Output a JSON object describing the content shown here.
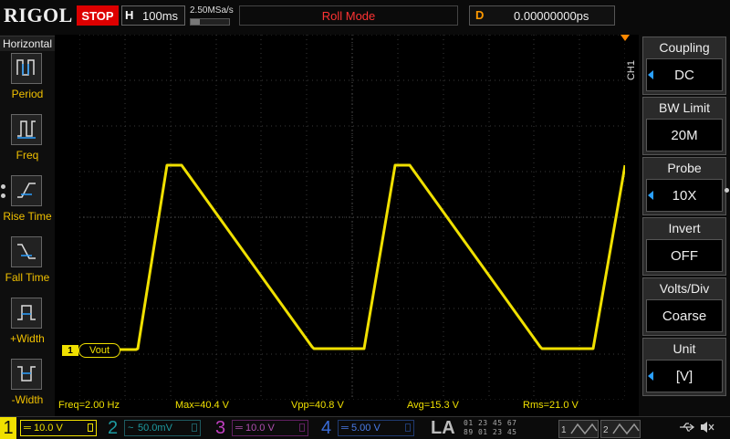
{
  "top": {
    "logo": "RIGOL",
    "run_state": "STOP",
    "timebase_tag": "H",
    "timebase": "100ms",
    "sample_rate": "2.50MSa/s",
    "mode": "Roll Mode",
    "delay_tag": "D",
    "delay": "0.00000000ps"
  },
  "left_menu": {
    "header": "Horizontal",
    "items": [
      {
        "label": "Period",
        "icon": "period-icon"
      },
      {
        "label": "Freq",
        "icon": "freq-icon"
      },
      {
        "label": "Rise Time",
        "icon": "rise-time-icon"
      },
      {
        "label": "Fall Time",
        "icon": "fall-time-icon"
      },
      {
        "label": "+Width",
        "icon": "positive-width-icon"
      },
      {
        "label": "-Width",
        "icon": "negative-width-icon"
      }
    ]
  },
  "right_menu": {
    "channel_tag": "CH1",
    "items": [
      {
        "title": "Coupling",
        "value": "DC"
      },
      {
        "title": "BW Limit",
        "value": "20M"
      },
      {
        "title": "Probe",
        "value": "10X"
      },
      {
        "title": "Invert",
        "value": "OFF"
      },
      {
        "title": "Volts/Div",
        "value": "Coarse"
      },
      {
        "title": "Unit",
        "value": "[V]"
      }
    ]
  },
  "trace": {
    "channel_marker": "1",
    "label": "Vout",
    "color": "#f0e000",
    "description_shape": "sawtooth (fast rise, slow fall, flat bottom)"
  },
  "measurements": {
    "freq": "Freq=2.00 Hz",
    "max": "Max=40.4 V",
    "vpp": "Vpp=40.8 V",
    "avg": "Avg=15.3 V",
    "rms": "Rms=21.0 V"
  },
  "bottom": {
    "channels": [
      {
        "num": "1",
        "coupling": "═",
        "scale": "10.0 V",
        "color": "#f0e000"
      },
      {
        "num": "2",
        "coupling": "~",
        "scale": "50.0mV",
        "color": "#1e9aa0"
      },
      {
        "num": "3",
        "coupling": "═",
        "scale": "10.0 V",
        "color": "#c040c0"
      },
      {
        "num": "4",
        "coupling": "═",
        "scale": "5.00 V",
        "color": "#3a6cd8"
      }
    ],
    "la_label": "LA",
    "la_digits_row1": "01 23 45 67",
    "la_digits_row2": "89 01 23 45",
    "gen1": "1",
    "gen2": "2"
  }
}
